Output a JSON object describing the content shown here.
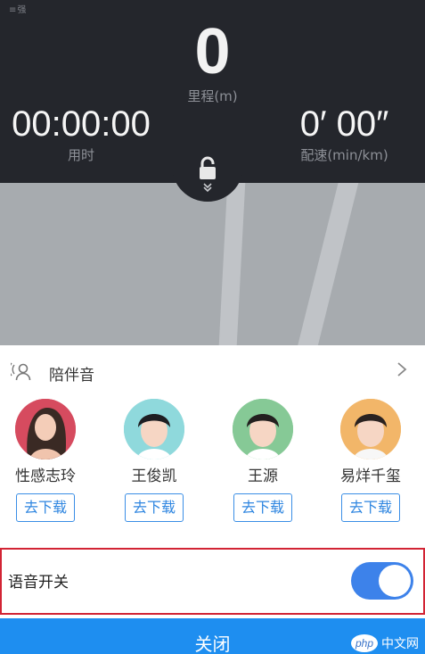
{
  "status": {
    "gps_label": "≡强"
  },
  "stats": {
    "distance_value": "0",
    "distance_label": "里程(m)",
    "time_value": "00:00:00",
    "time_label": "用时",
    "pace_value": "0′ 00″",
    "pace_label": "配速(min/km)"
  },
  "lock": {
    "icon": "lock-icon",
    "chevron": "˅˅"
  },
  "companion": {
    "label": "陪伴音",
    "voices": [
      {
        "name": "性感志玲",
        "button": "去下载",
        "bg": "#e05a6a"
      },
      {
        "name": "王俊凯",
        "button": "去下载",
        "bg": "#7fd3d6"
      },
      {
        "name": "王源",
        "button": "去下载",
        "bg": "#7fc98f"
      },
      {
        "name": "易烊千玺",
        "button": "去下载",
        "bg": "#f3b76a"
      }
    ]
  },
  "voice_switch": {
    "label": "语音开关",
    "on": true
  },
  "close": {
    "label": "关闭"
  },
  "watermark": {
    "text": "php 中文网"
  },
  "colors": {
    "accent": "#3d82ea",
    "highlight_border": "#d22434",
    "panel": "#24262c"
  }
}
